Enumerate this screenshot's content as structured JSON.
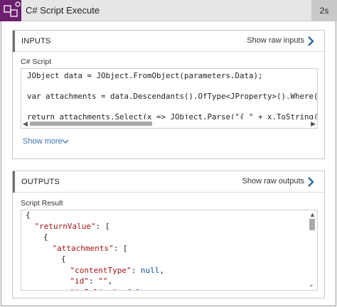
{
  "header": {
    "title": "C# Script Execute",
    "duration": "2s",
    "icon": "connector-icon",
    "icon_bg": "#6b1f6e"
  },
  "inputs": {
    "title": "INPUTS",
    "show_raw_label": "Show raw inputs",
    "field_label": "C# Script",
    "code_lines": [
      "JObject data = JObject.FromObject(parameters.Data);",
      "var attachments = data.Descendants().OfType<JProperty>().Where(x =>",
      "return attachments.Select(x => JObject.Parse(\"{ \" + x.ToString() + \""
    ],
    "show_more_label": "Show more"
  },
  "outputs": {
    "title": "OUTPUTS",
    "show_raw_label": "Show raw outputs",
    "field_label": "Script Result",
    "json_lines": [
      {
        "indent": 0,
        "text": "{"
      },
      {
        "indent": 1,
        "key": "\"returnValue\"",
        "rest": ": ["
      },
      {
        "indent": 2,
        "text": "{"
      },
      {
        "indent": 3,
        "key": "\"attachments\"",
        "rest": ": ["
      },
      {
        "indent": 4,
        "text": "{"
      },
      {
        "indent": 5,
        "key": "\"contentType\"",
        "sep": ": ",
        "value": "null",
        "valtype": "kw",
        "tail": ","
      },
      {
        "indent": 5,
        "key": "\"id\"",
        "sep": ": ",
        "value": "\"\"",
        "valtype": "str",
        "tail": ","
      },
      {
        "indent": 5,
        "key": "\"isInline\"",
        "sep": ": ",
        "value": "false",
        "valtype": "kw",
        "tail": ","
      }
    ]
  },
  "colors": {
    "accent_link": "#3a6fb0",
    "chevron": "#1f5a96",
    "json_key": "#a31515",
    "json_keyword": "#0451a5"
  }
}
